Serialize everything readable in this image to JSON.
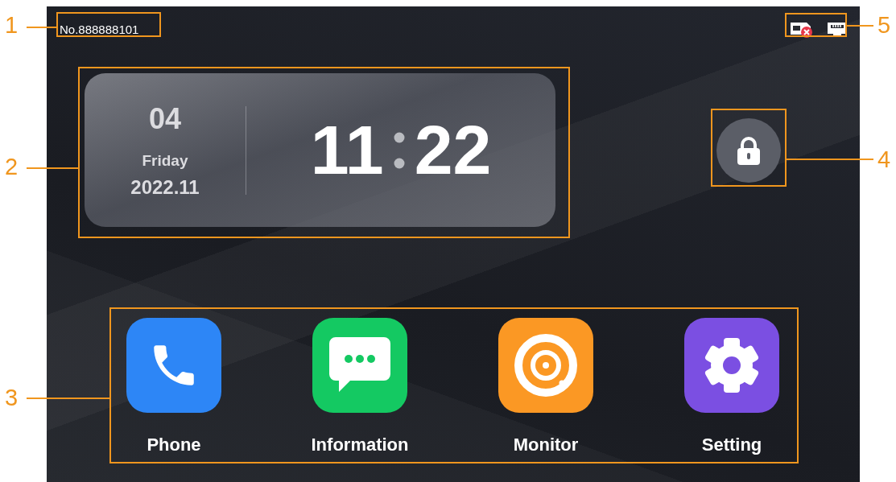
{
  "screen": {
    "device_number": "No.888888101",
    "clock": {
      "day": "04",
      "weekday": "Friday",
      "year_month": "2022.11",
      "hours": "11",
      "minutes": "22"
    },
    "apps": [
      {
        "kind": "phone",
        "label": "Phone",
        "color": "#2d86f6"
      },
      {
        "kind": "message",
        "label": "Information",
        "color": "#14c962"
      },
      {
        "kind": "camera",
        "label": "Monitor",
        "color": "#fb9824"
      },
      {
        "kind": "settings",
        "label": "Setting",
        "color": "#7b4fe2"
      }
    ]
  },
  "callouts": [
    "1",
    "5",
    "2",
    "4",
    "3"
  ]
}
